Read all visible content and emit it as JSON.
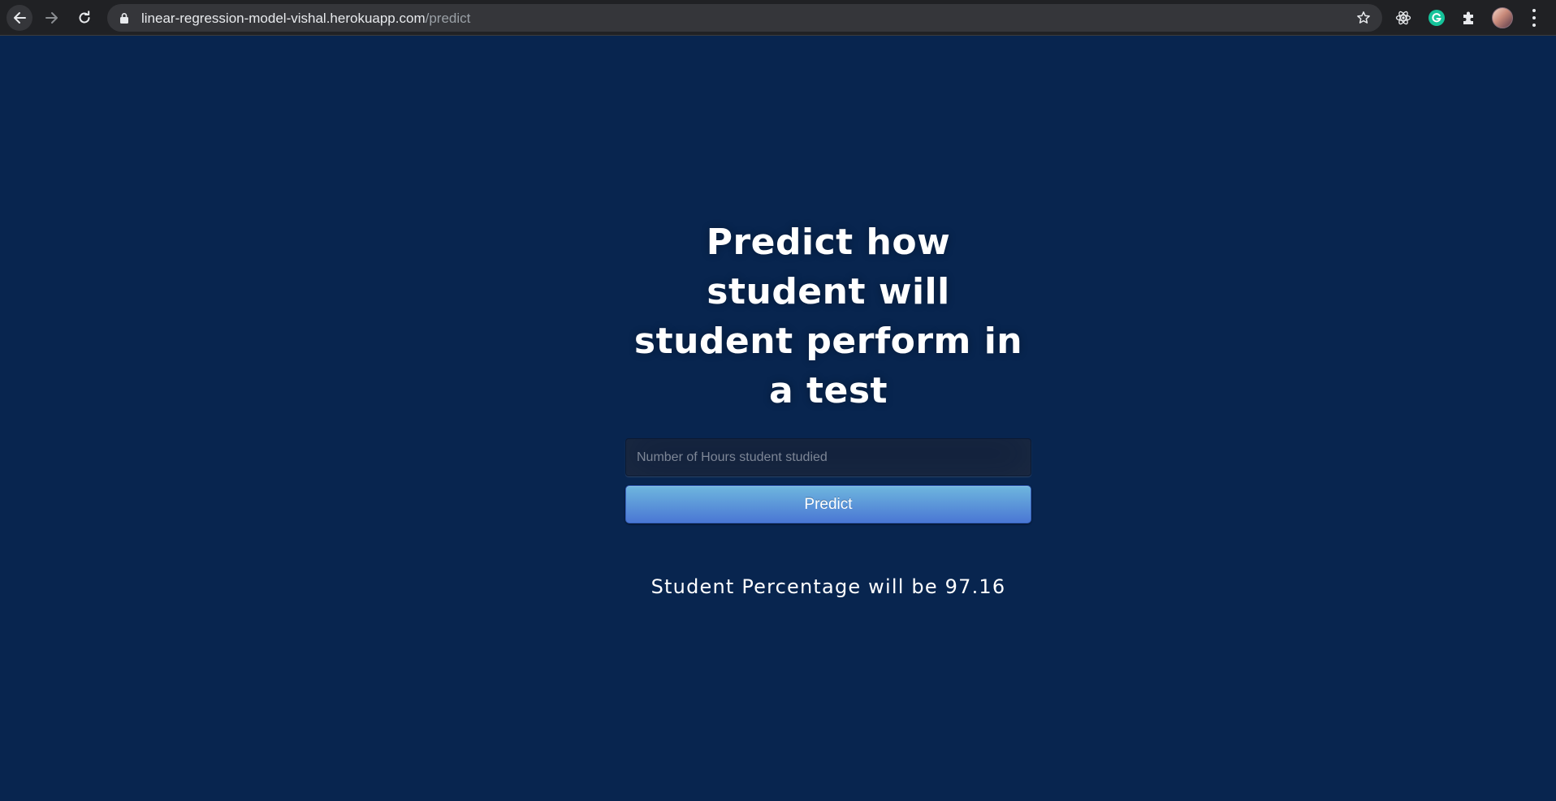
{
  "browser": {
    "url_host": "linear-regression-model-vishal.herokuapp.com",
    "url_path": "/predict",
    "extensions": [
      "react-devtools-icon",
      "grammarly-icon",
      "extensions-puzzle-icon"
    ]
  },
  "form": {
    "title": "Predict how student will student perform in a test",
    "hours_placeholder": "Number of Hours student studied",
    "hours_value": "",
    "predict_label": "Predict"
  },
  "result": {
    "text": "Student Percentage will be 97.16"
  },
  "colors": {
    "page_background": "#08254f",
    "button_top": "#6eb6de",
    "button_bottom": "#4a77d4",
    "browser_chrome": "#202124"
  }
}
